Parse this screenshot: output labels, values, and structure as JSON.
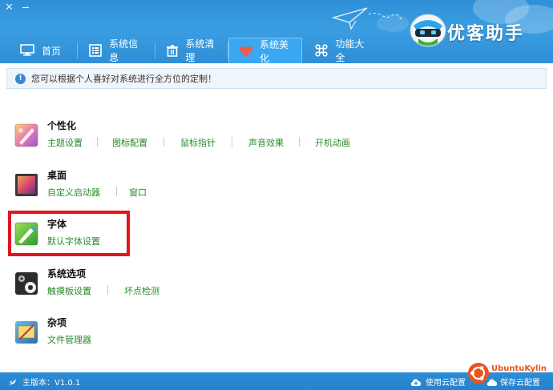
{
  "window": {
    "close_glyph": "✕",
    "minimize_glyph": "—"
  },
  "header": {
    "brand": "优客助手",
    "logo_icon": "robot-logo-icon",
    "deco_icon": "paper-plane-icon"
  },
  "tabs": [
    {
      "label": "首页",
      "icon": "monitor-icon",
      "active": false
    },
    {
      "label": "系统信息",
      "icon": "list-icon",
      "active": false
    },
    {
      "label": "系统清理",
      "icon": "trash-icon",
      "active": false
    },
    {
      "label": "系统美化",
      "icon": "heart-icon",
      "active": true
    },
    {
      "label": "功能大全",
      "icon": "command-icon",
      "active": false
    }
  ],
  "info_message": "您可以根据个人喜好对系统进行全方位的定制！",
  "sections": [
    {
      "title": "个性化",
      "icon": "brush-palette-icon",
      "links": [
        "主题设置",
        "图标配置",
        "鼠标指针",
        "声音效果",
        "开机动画"
      ]
    },
    {
      "title": "桌面",
      "icon": "desktop-screen-icon",
      "links": [
        "自定义启动器",
        "窗口"
      ]
    },
    {
      "title": "字体",
      "icon": "pen-font-icon",
      "links": [
        "默认字体设置"
      ]
    },
    {
      "title": "系统选项",
      "icon": "settings-gears-icon",
      "links": [
        "触摸板设置",
        "坏点检测"
      ]
    },
    {
      "title": "杂项",
      "icon": "misc-tools-icon",
      "links": [
        "文件管理器"
      ]
    }
  ],
  "status": {
    "version": "主版本：V1.0.1",
    "use_cloud": "使用云配置",
    "save_cloud": "保存云配置",
    "watermark": "UbuntuKylin"
  },
  "colors": {
    "header": "#3399dd",
    "link": "#2a8a2a",
    "highlight": "#e3141b",
    "status": "#2a88d0"
  }
}
